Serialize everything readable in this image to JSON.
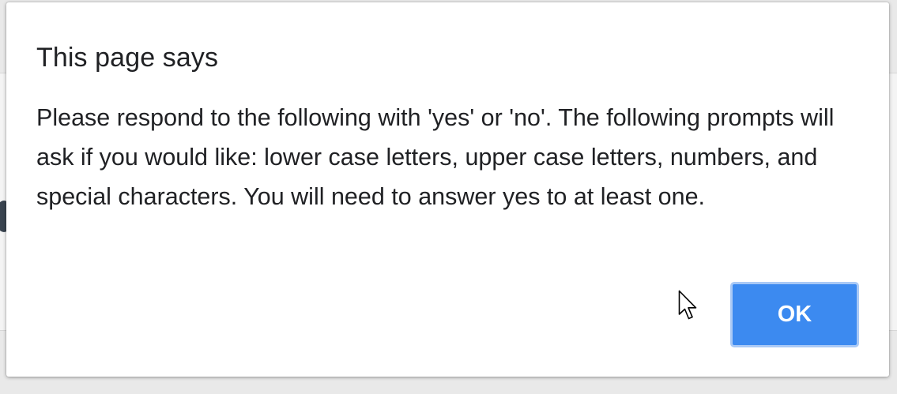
{
  "dialog": {
    "title": "This page says",
    "message": "Please respond to the following with 'yes' or 'no'. The following prompts will ask if you would like: lower case letters, upper case letters, numbers, and special characters. You will need to answer yes to at least one.",
    "ok_label": "OK"
  },
  "colors": {
    "button": "#3c8af0",
    "button_border": "#a9c9f6",
    "text": "#202124"
  },
  "icons": {
    "cursor": "mouse-pointer-icon"
  }
}
